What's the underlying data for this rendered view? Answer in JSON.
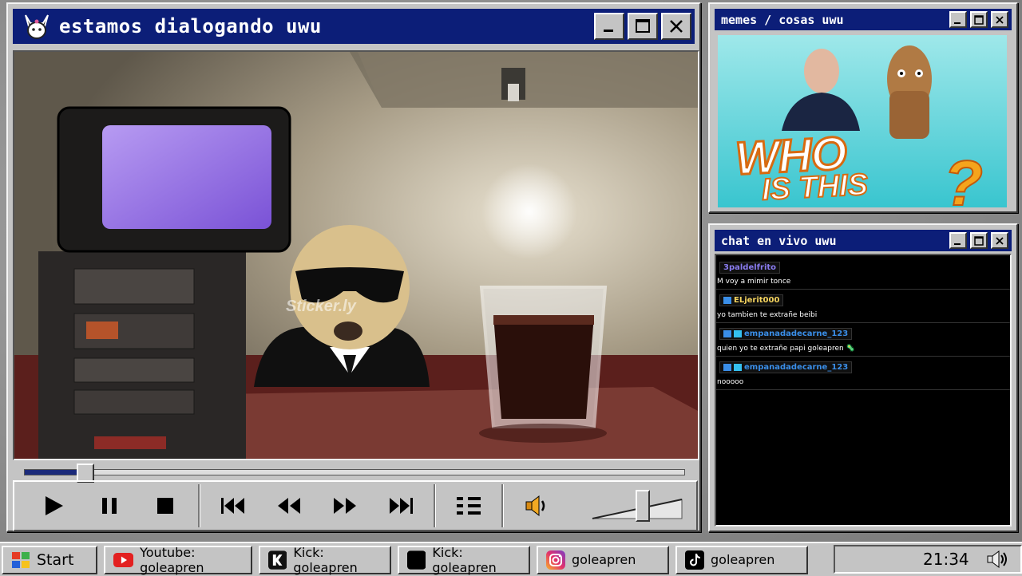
{
  "main_window": {
    "title": "estamos dialogando uwu",
    "seek_progress": 0.09,
    "volume_level": 0.55,
    "video_watermark": "Sticker.ly"
  },
  "memes_window": {
    "title": "memes / cosas uwu",
    "image_caption_line1": "WHO",
    "image_caption_line2": "IS THIS",
    "image_caption_mark": "?"
  },
  "chat_window": {
    "title": "chat en vivo uwu",
    "messages": [
      {
        "user": "3paldelfrito",
        "text": "M voy a mimir tonce",
        "user_color": "#8a7cf0",
        "badge": false
      },
      {
        "user": "ELjerit000",
        "text": "yo tambien te extrañe beibi",
        "user_color": "#f4d35e",
        "badge": true
      },
      {
        "user": "empanadadecarne_123",
        "text": "quien yo te extrañe papi goleapren 🦠",
        "user_color": "#3a8ee8",
        "badge": true
      },
      {
        "user": "empanadadecarne_123",
        "text": "nooooo",
        "user_color": "#3a8ee8",
        "badge": true
      }
    ]
  },
  "taskbar": {
    "start_label": "Start",
    "tasks": [
      {
        "label": "Youtube: goleapren",
        "icon": "youtube-icon"
      },
      {
        "label": "Kick: goleapren",
        "icon": "kick-icon"
      },
      {
        "label": "Kick: goleapren",
        "icon": "kick-icon"
      },
      {
        "label": "goleapren",
        "icon": "instagram-icon"
      },
      {
        "label": "goleapren",
        "icon": "tiktok-icon"
      }
    ],
    "clock": "21:34"
  },
  "colors": {
    "titlebar": "#0c1e78",
    "window": "#c4c4c4",
    "chat_bg": "#000000"
  }
}
